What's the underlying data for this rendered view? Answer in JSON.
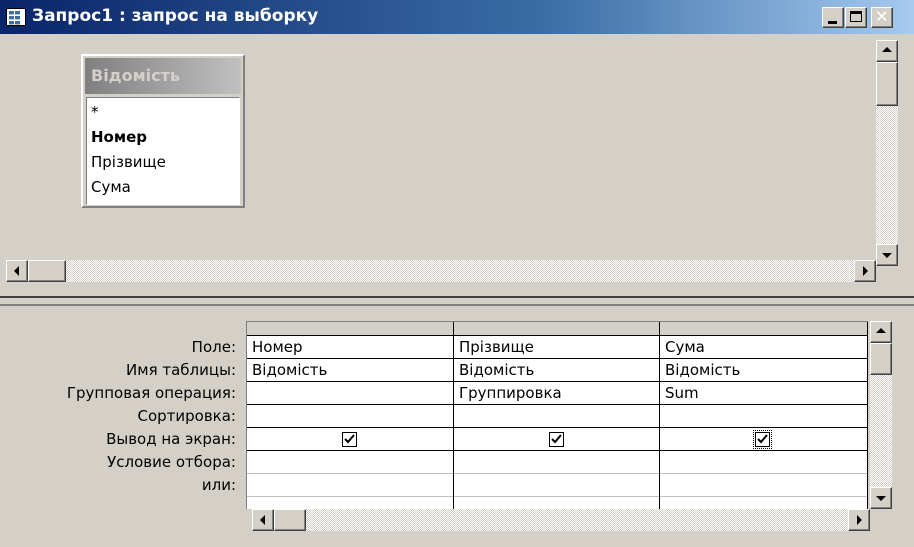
{
  "window": {
    "title": "Запрос1 : запрос на выборку"
  },
  "table_box": {
    "title": "Відомість",
    "fields": [
      {
        "label": "*",
        "key": false
      },
      {
        "label": "Номер",
        "key": true
      },
      {
        "label": "Прізвище",
        "key": false
      },
      {
        "label": "Сума",
        "key": false
      }
    ]
  },
  "row_labels": {
    "field": "Поле:",
    "table": "Имя таблицы:",
    "group": "Групповая операция:",
    "sort": "Сортировка:",
    "show": "Вывод на экран:",
    "criteria": "Условие отбора:",
    "or": "или:"
  },
  "columns": [
    {
      "field": "Номер",
      "table": "Відомість",
      "group": "",
      "sort": "",
      "show": true,
      "criteria": "",
      "or": ""
    },
    {
      "field": "Прізвище",
      "table": "Відомість",
      "group": "Группировка",
      "sort": "",
      "show": true,
      "criteria": "",
      "or": ""
    },
    {
      "field": "Сума",
      "table": "Відомість",
      "group": "Sum",
      "sort": "",
      "show": true,
      "criteria": "",
      "or": ""
    }
  ]
}
